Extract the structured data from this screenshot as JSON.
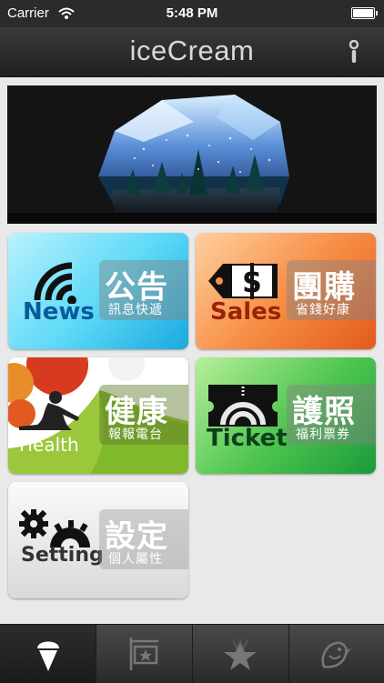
{
  "status": {
    "carrier": "Carrier",
    "time": "5:48 PM"
  },
  "navbar": {
    "title": "iceCream",
    "info_icon": "info-icon"
  },
  "banner": {
    "image": "snow-globe-crystal-photo"
  },
  "tiles": {
    "news": {
      "en": "News",
      "cn": "公告",
      "sub": "訊息快遞",
      "icon": "wifi-broadcast-icon"
    },
    "sales": {
      "en": "Sales",
      "cn": "團購",
      "sub": "省錢好康",
      "icon": "price-tag-dollar-icon"
    },
    "health": {
      "en": "Health",
      "cn": "健康",
      "sub": "報報電台",
      "icon": "yoga-figure-icon"
    },
    "ticket": {
      "en": "Ticket",
      "cn": "護照",
      "sub": "福利票券",
      "icon": "ticket-icon"
    },
    "setting": {
      "en": "Setting",
      "cn": "設定",
      "sub": "個人屬性",
      "icon": "gears-icon"
    }
  },
  "tabbar": {
    "items": [
      {
        "icon": "ice-cream-icon",
        "selected": true
      },
      {
        "icon": "star-signboard-icon",
        "selected": false
      },
      {
        "icon": "w-star-icon",
        "selected": false
      },
      {
        "icon": "bird-icon",
        "selected": false
      }
    ]
  }
}
